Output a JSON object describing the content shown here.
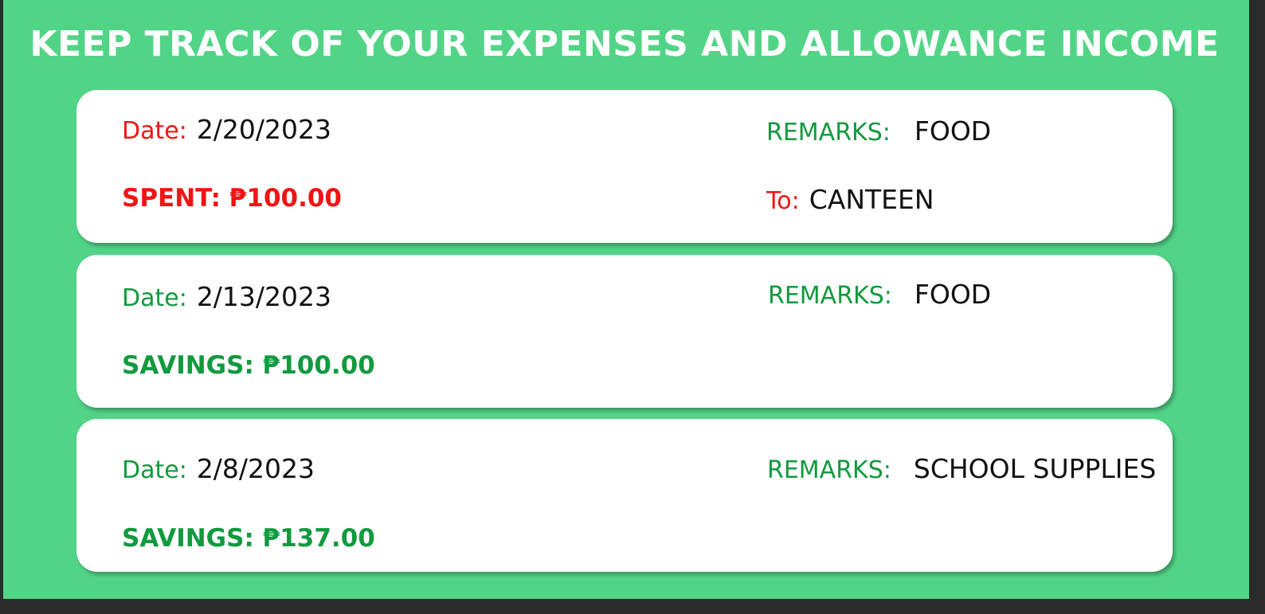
{
  "header": {
    "title": "KEEP TRACK OF YOUR EXPENSES AND ALLOWANCE INCOME"
  },
  "colors": {
    "background": "#52d487",
    "expense_red": "#f01414",
    "savings_green": "#119a3e",
    "card": "#ffffff",
    "text": "#111111"
  },
  "labels": {
    "date": "Date:",
    "remarks": "REMARKS:",
    "to": "To:"
  },
  "entries": [
    {
      "type": "spent",
      "date": "2/20/2023",
      "remarks": "FOOD",
      "amount": "SPENT: ₱100.00",
      "to": "CANTEEN"
    },
    {
      "type": "savings",
      "date": "2/13/2023",
      "remarks": "FOOD",
      "amount": "SAVINGS: ₱100.00"
    },
    {
      "type": "savings",
      "date": "2/8/2023",
      "remarks": "SCHOOL SUPPLIES",
      "amount": "SAVINGS: ₱137.00"
    }
  ]
}
